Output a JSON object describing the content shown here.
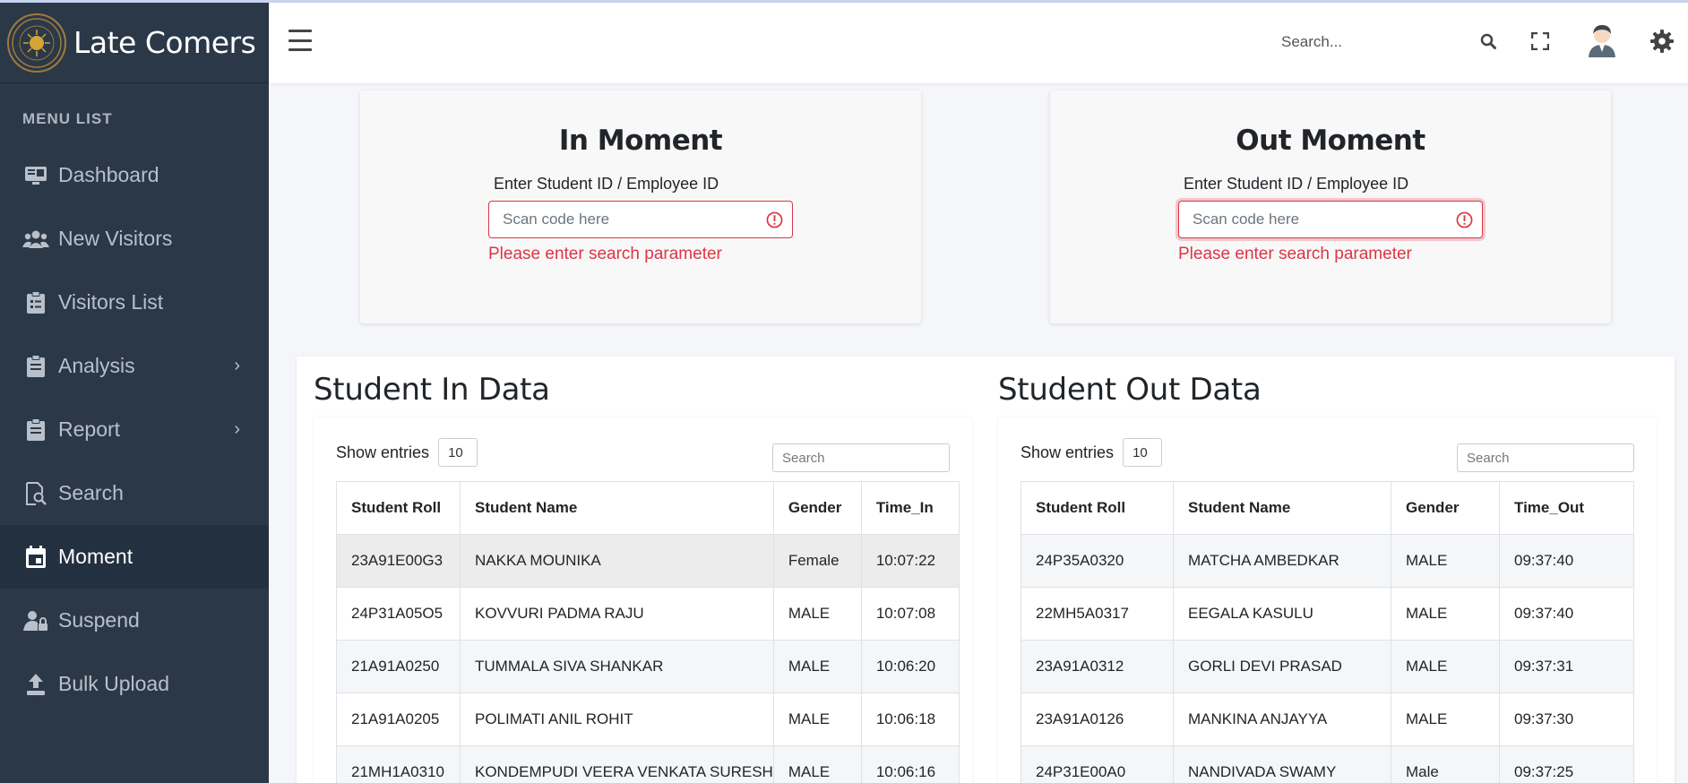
{
  "brand": {
    "title": "Late Comers"
  },
  "sidebar": {
    "menu_title": "MENU LIST",
    "items": [
      {
        "label": "Dashboard",
        "icon": "monitor-icon"
      },
      {
        "label": "New Visitors",
        "icon": "users-icon"
      },
      {
        "label": "Visitors List",
        "icon": "clipboard-list-icon"
      },
      {
        "label": "Analysis",
        "icon": "clipboard-icon",
        "has_submenu": true
      },
      {
        "label": "Report",
        "icon": "clipboard-icon",
        "has_submenu": true
      },
      {
        "label": "Search",
        "icon": "file-search-icon"
      },
      {
        "label": "Moment",
        "icon": "calendar-icon",
        "active": true
      },
      {
        "label": "Suspend",
        "icon": "user-lock-icon"
      },
      {
        "label": "Bulk Upload",
        "icon": "upload-icon"
      }
    ]
  },
  "topbar": {
    "search_placeholder": "Search..."
  },
  "in_moment": {
    "title": "In Moment",
    "label": "Enter Student ID / Employee ID",
    "placeholder": "Scan code here",
    "error": "Please enter search parameter"
  },
  "out_moment": {
    "title": "Out Moment",
    "label": "Enter Student ID / Employee ID",
    "placeholder": "Scan code here",
    "error": "Please enter search parameter"
  },
  "in_data": {
    "title": "Student In Data",
    "show_entries_label": "Show entries",
    "entries": "10",
    "search_placeholder": "Search",
    "headers": [
      "Student Roll",
      "Student Name",
      "Gender",
      "Time_In"
    ],
    "rows": [
      [
        "23A91E00G3",
        "NAKKA MOUNIKA",
        "Female",
        "10:07:22"
      ],
      [
        "24P31A05O5",
        "KOVVURI PADMA RAJU",
        "MALE",
        "10:07:08"
      ],
      [
        "21A91A0250",
        "TUMMALA SIVA SHANKAR",
        "MALE",
        "10:06:20"
      ],
      [
        "21A91A0205",
        "POLIMATI ANIL ROHIT",
        "MALE",
        "10:06:18"
      ],
      [
        "21MH1A0310",
        "KONDEMPUDI VEERA VENKATA SURESH",
        "MALE",
        "10:06:16"
      ]
    ]
  },
  "out_data": {
    "title": "Student Out Data",
    "show_entries_label": "Show entries",
    "entries": "10",
    "search_placeholder": "Search",
    "headers": [
      "Student Roll",
      "Student Name",
      "Gender",
      "Time_Out"
    ],
    "rows": [
      [
        "24P35A0320",
        "MATCHA AMBEDKAR",
        "MALE",
        "09:37:40"
      ],
      [
        "22MH5A0317",
        "EEGALA KASULU",
        "MALE",
        "09:37:40"
      ],
      [
        "23A91A0312",
        "GORLI DEVI PRASAD",
        "MALE",
        "09:37:31"
      ],
      [
        "23A91A0126",
        "MANKINA ANJAYYA",
        "MALE",
        "09:37:30"
      ],
      [
        "24P31E00A0",
        "NANDIVADA SWAMY",
        "Male",
        "09:37:25"
      ]
    ]
  },
  "colors": {
    "sidebar": "#2b3848",
    "error": "#dc3545",
    "active_menu": "#223040"
  }
}
